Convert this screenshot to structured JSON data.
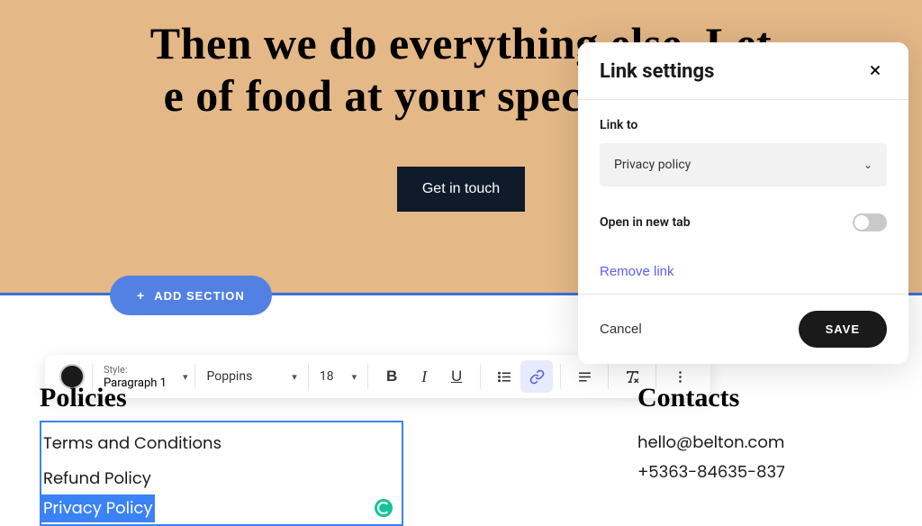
{
  "hero": {
    "line1": "Then we do everything else. Let",
    "line2": "e of food at your special event.",
    "cta": "Get in touch"
  },
  "add_section_label": "ADD SECTION",
  "toolbar": {
    "style_label": "Style:",
    "style_value": "Paragraph 1",
    "font": "Poppins",
    "size": "18"
  },
  "footer": {
    "policies": {
      "heading": "Policies",
      "items": [
        "Terms and Conditions",
        "Refund Policy",
        "Privacy Policy"
      ]
    },
    "contacts": {
      "heading": "Contacts",
      "email": "hello@belton.com",
      "phone": "+5363-84635-837"
    }
  },
  "popup": {
    "title": "Link settings",
    "link_to_label": "Link to",
    "link_to_value": "Privacy policy",
    "open_new_tab_label": "Open in new tab",
    "open_new_tab": false,
    "remove_link": "Remove link",
    "cancel": "Cancel",
    "save": "SAVE"
  }
}
